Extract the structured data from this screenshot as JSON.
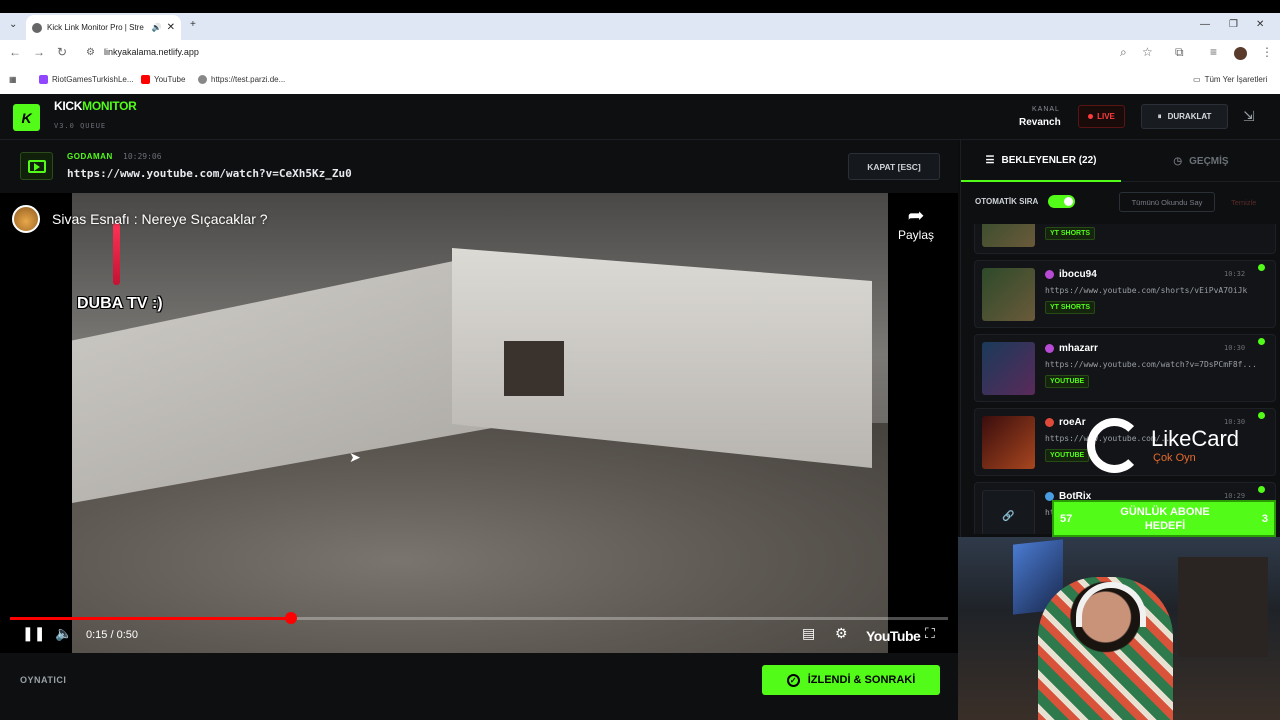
{
  "browser": {
    "tab_title": "Kick Link Monitor Pro | Stre",
    "url": "linkyakalama.netlify.app",
    "bookmarks": [
      "RiotGamesTurkishLe...",
      "YouTube",
      "https://test.parzi.de..."
    ],
    "all_bookmarks": "Tüm Yer İşaretleri"
  },
  "header": {
    "brand_a": "KICK",
    "brand_b": "MONITOR",
    "version": "V3.0 QUEUE",
    "channel_label": "KANAL",
    "channel_name": "Revanch",
    "live_label": "LIVE",
    "pause_label": "DURAKLAT"
  },
  "player": {
    "user": "GODAMAN",
    "time": "10:29:06",
    "url": "https://www.youtube.com/watch?v=CeXh5Kz_Zu0",
    "close_label": "KAPAT [ESC]",
    "video_title": "Sivas Esnafı : Nereye Sıçacaklar ?",
    "watermark": "DUBA TV :)",
    "share_label": "Paylaş",
    "time_display": "0:15 / 0:50",
    "progress": 0.3,
    "yt_logo": "YouTube",
    "footer_label": "OYNATICI",
    "next_label": "İZLENDİ & SONRAKİ"
  },
  "sidebar": {
    "tab_queue": "BEKLEYENLER (22)",
    "tab_history": "GEÇMİŞ",
    "auto_label": "OTOMATİK SIRA",
    "mark_all": "Tümünü Okundu Say",
    "clear": "Temizle",
    "items": [
      {
        "name": "",
        "time": "",
        "url": "",
        "tag": "YT SHORTS",
        "dot": "#e0b23a"
      },
      {
        "name": "ibocu94",
        "time": "10:32",
        "url": "https://www.youtube.com/shorts/vEiPvA7OiJk",
        "tag": "YT SHORTS",
        "dot": "#b84ad6"
      },
      {
        "name": "mhazarr",
        "time": "10:30",
        "url": "https://www.youtube.com/watch?v=7DsPCmF8f...",
        "tag": "YOUTUBE",
        "dot": "#b84ad6"
      },
      {
        "name": "roeAr",
        "time": "10:30",
        "url": "https://www.youtube.com/...",
        "tag": "YOUTUBE",
        "dot": "#e04a3a"
      },
      {
        "name": "BotRix",
        "time": "10:29",
        "url": "ht",
        "tag": "",
        "dot": "#4a9de0"
      }
    ]
  },
  "overlay": {
    "likecard": "LikeCard",
    "likecard_sub": "Çok Oyn",
    "goal_left": "57",
    "goal_text": "GÜNLÜK ABONE HEDEFİ",
    "goal_right": "3"
  },
  "colors": {
    "accent": "#53fc18",
    "live": "#ff3b3b"
  }
}
